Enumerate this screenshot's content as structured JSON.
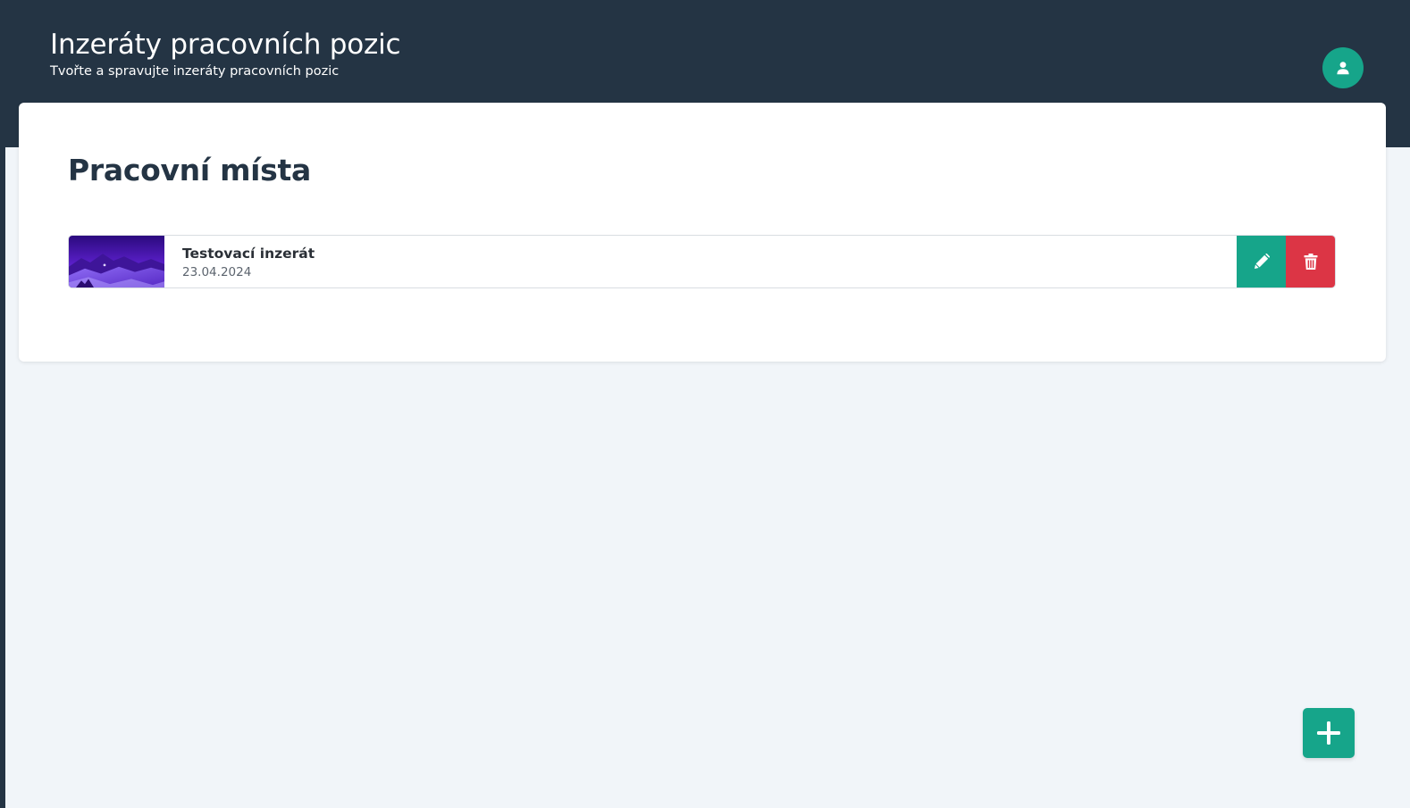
{
  "header": {
    "title": "Inzeráty pracovních pozic",
    "subtitle": "Tvořte a spravujte inzeráty pracovních pozic"
  },
  "main": {
    "section_title": "Pracovní místa",
    "jobs": [
      {
        "title": "Testovací inzerát",
        "date": "23.04.2024"
      }
    ]
  },
  "icons": {
    "avatar": "user-icon",
    "edit": "pencil-icon",
    "delete": "trash-icon",
    "add": "plus-icon"
  },
  "colors": {
    "header_bg": "#243444",
    "accent": "#16a58a",
    "danger": "#dc3545",
    "page_bg": "#f1f5f9",
    "card_bg": "#ffffff"
  }
}
